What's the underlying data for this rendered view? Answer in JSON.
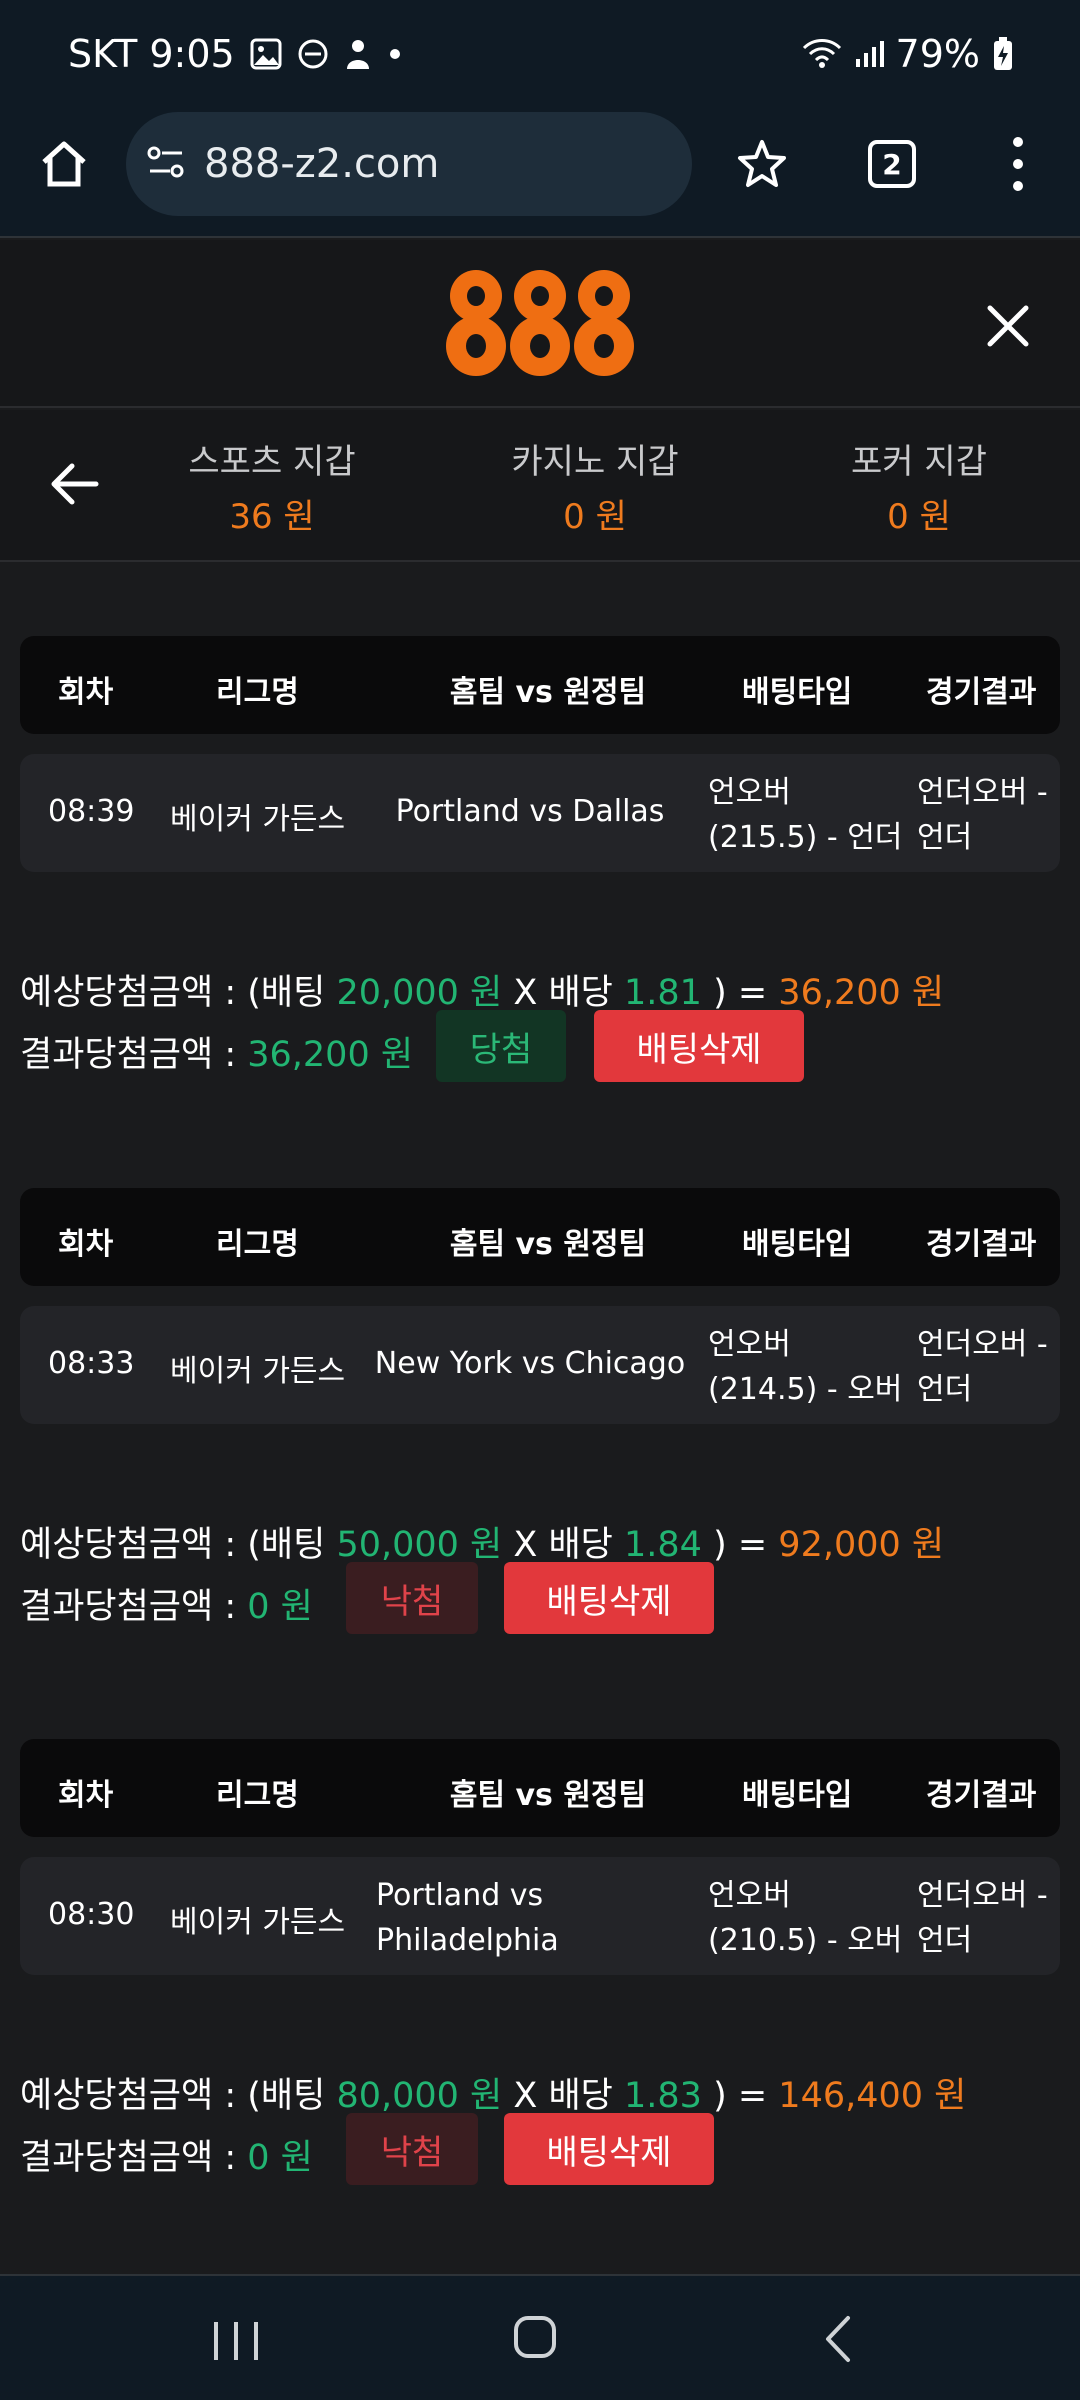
{
  "status_bar": {
    "carrier_time": "SKT 9:05",
    "battery": "79%"
  },
  "browser": {
    "url": "888-z2.com",
    "tab_count": "2"
  },
  "header": {
    "logo_text": "888"
  },
  "wallets": [
    {
      "label": "스포츠 지갑",
      "value": "36 원"
    },
    {
      "label": "카지노 지갑",
      "value": "0 원"
    },
    {
      "label": "포커 지갑",
      "value": "0 원"
    }
  ],
  "table_headers": [
    "회차",
    "리그명",
    "홈팀 vs 원정팀",
    "배팅타입",
    "경기결과"
  ],
  "bets": [
    {
      "round": "08:39",
      "league": "베이커 가든스",
      "match": "Portland vs Dallas",
      "bet_type_line1": "언오버",
      "bet_type_line2": "(215.5) - 언더",
      "result_line1": "언더오버 -",
      "result_line2": "언더",
      "expected_prefix": "예상당첨금액 : (배팅 ",
      "stake": "20,000 원",
      "odds_prefix": " X 배당 ",
      "odds": "1.81",
      "eq": " ) = ",
      "expected_amount": "36,200 원",
      "result_prefix": "결과당첨금액 : ",
      "result_amount": "36,200 원",
      "status": "당첨",
      "delete_label": "배팅삭제"
    },
    {
      "round": "08:33",
      "league": "베이커 가든스",
      "match": "New York vs Chicago",
      "bet_type_line1": "언오버",
      "bet_type_line2": "(214.5) - 오버",
      "result_line1": "언더오버 -",
      "result_line2": "언더",
      "expected_prefix": "예상당첨금액 : (배팅 ",
      "stake": "50,000 원",
      "odds_prefix": " X 배당 ",
      "odds": "1.84",
      "eq": " ) = ",
      "expected_amount": "92,000 원",
      "result_prefix": "결과당첨금액 : ",
      "result_amount": "0 원",
      "status": "낙첨",
      "delete_label": "배팅삭제"
    },
    {
      "round": "08:30",
      "league": "베이커 가든스",
      "match_line1": "Portland vs",
      "match_line2": "Philadelphia",
      "bet_type_line1": "언오버",
      "bet_type_line2": "(210.5) - 오버",
      "result_line1": "언더오버 -",
      "result_line2": "언더",
      "expected_prefix": "예상당첨금액 : (배팅 ",
      "stake": "80,000 원",
      "odds_prefix": " X 배당 ",
      "odds": "1.83",
      "eq": " ) = ",
      "expected_amount": "146,400 원",
      "result_prefix": "결과당첨금액 : ",
      "result_amount": "0 원",
      "status": "낙첨",
      "delete_label": "배팅삭제"
    }
  ],
  "colors": {
    "accent": "#ef7b1e",
    "green": "#22b573",
    "delete": "#e2383c",
    "background": "#1a1b1d"
  }
}
